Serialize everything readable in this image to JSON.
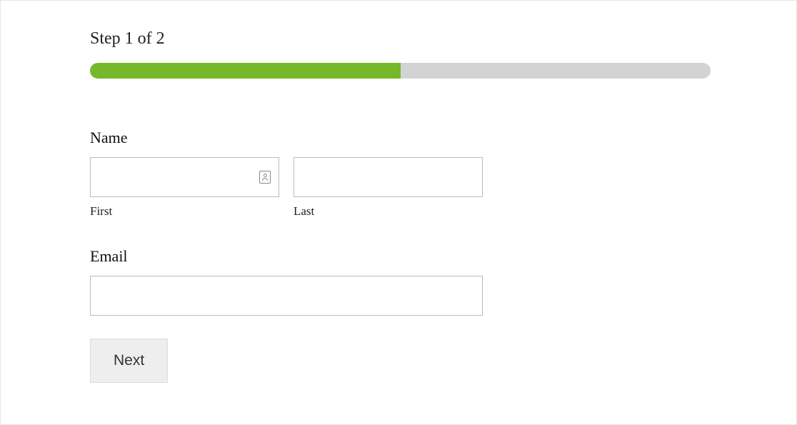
{
  "step": {
    "title": "Step 1 of 2",
    "progress_percent": 50
  },
  "form": {
    "name": {
      "label": "Name",
      "first_sublabel": "First",
      "last_sublabel": "Last",
      "first_value": "",
      "last_value": ""
    },
    "email": {
      "label": "Email",
      "value": ""
    }
  },
  "buttons": {
    "next": "Next"
  }
}
